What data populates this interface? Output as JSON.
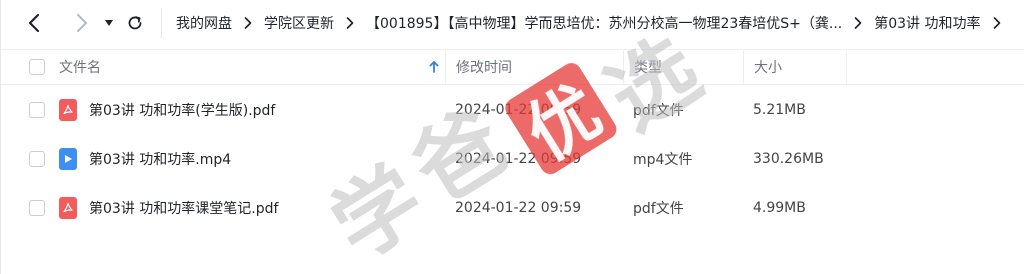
{
  "toolbar": {
    "back_icon": "chevron-left-icon",
    "forward_icon": "chevron-right-icon",
    "dropdown_icon": "caret-down-icon",
    "refresh_icon": "refresh-icon"
  },
  "breadcrumb": [
    {
      "label": "我的网盘"
    },
    {
      "label": "学院区更新"
    },
    {
      "label": "【001895】【高中物理】学而思培优：苏州分校高一物理23春培优S+（龚..."
    },
    {
      "label": "第03讲 功和功率"
    }
  ],
  "table": {
    "headers": {
      "name": "文件名",
      "time": "修改时间",
      "type": "类型",
      "size": "大小"
    },
    "sort_icon": "arrow-up-icon",
    "rows": [
      {
        "icon": "pdf-file-icon",
        "name": "第03讲 功和功率(学生版).pdf",
        "time": "2024-01-22 09:59",
        "type": "pdf文件",
        "size": "5.21MB"
      },
      {
        "icon": "video-file-icon",
        "name": "第03讲 功和功率.mp4",
        "time": "2024-01-22 09:59",
        "type": "mp4文件",
        "size": "330.26MB"
      },
      {
        "icon": "pdf-file-icon",
        "name": "第03讲 功和功率课堂笔记.pdf",
        "time": "2024-01-22 09:59",
        "type": "pdf文件",
        "size": "4.99MB"
      }
    ]
  },
  "watermark": {
    "text_left": "学",
    "text_mid": "爸",
    "text_stamp": "优",
    "text_right": "选",
    "stamp_color": "#e53935",
    "gray_color": "#c8c8c8"
  },
  "colors": {
    "pdf_icon": "#f25c5c",
    "mp4_icon": "#3d8ff0",
    "sort_arrow": "#2f7ff0"
  }
}
